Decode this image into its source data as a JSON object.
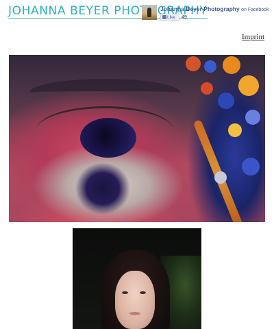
{
  "header": {
    "site_title": "Johanna Beyer Photography"
  },
  "facebook_widget": {
    "page_name": "Johanna Beyer Photography",
    "suffix": "on Facebook",
    "like_label": "Like",
    "like_count": "49"
  },
  "nav": {
    "imprint_label": "Imprint"
  },
  "colors": {
    "title_accent": "#2bb3b8",
    "facebook_blue": "#3b5998"
  },
  "gallery": {
    "photos": [
      "eye-closeup-photo",
      "portrait-photo"
    ]
  }
}
